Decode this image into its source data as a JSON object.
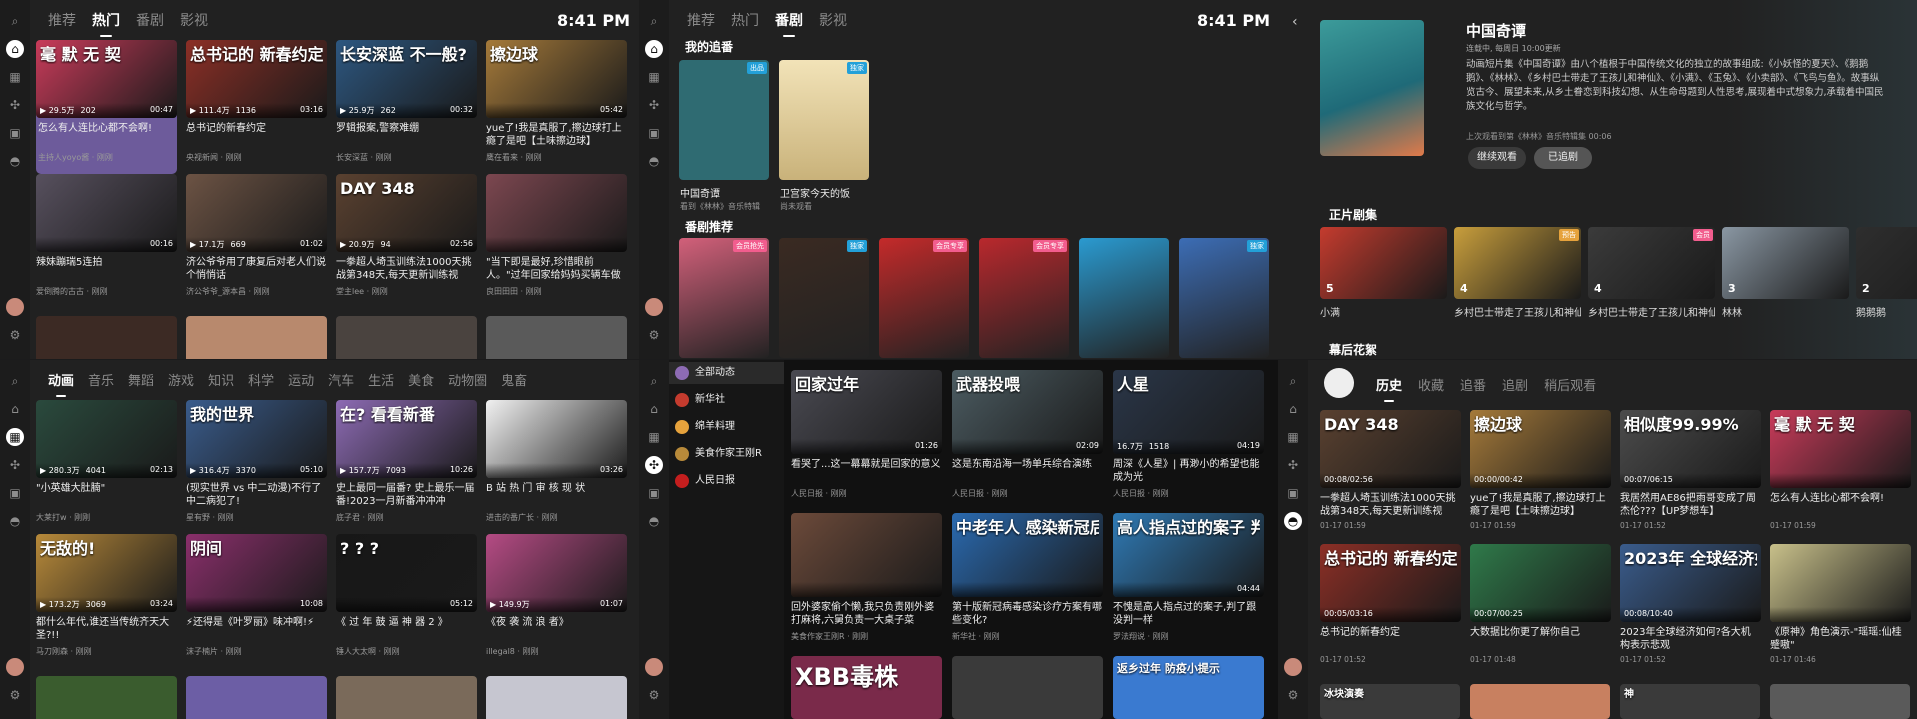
{
  "colors": {
    "bg": "#212121",
    "rail": "#1c1c1c",
    "accent": "#ffffff",
    "highlight": "#6d5b9b"
  },
  "p1": {
    "tabs": [
      "推荐",
      "热门",
      "番剧",
      "影视"
    ],
    "active_tab": 1,
    "time": "8:41 PM",
    "cards": [
      {
        "thumb_text": "毫 默 无 契",
        "title": "怎么有人连比心都不会啊!",
        "uploader": "主持人yoyo酱 · 刚刚",
        "views": "29.5万",
        "danmaku": "202",
        "duration": "00:47",
        "bg": "#c93b5a",
        "hl": true
      },
      {
        "thumb_text": "总书记的 新春约定",
        "title": "总书记的新春约定",
        "uploader": "央视新闻 · 刚刚",
        "views": "111.4万",
        "danmaku": "1136",
        "duration": "03:16",
        "bg": "#8c2f26"
      },
      {
        "thumb_text": "长安深蓝 不一般?",
        "title": "罗辑报案,警察难绷",
        "uploader": "长安深蓝 · 刚刚",
        "views": "25.9万",
        "danmaku": "262",
        "duration": "00:32",
        "bg": "#2d5780"
      },
      {
        "thumb_text": "擦边球",
        "title": "yue了!我是真服了,擦边球打上瘾了是吧【土味擦边球】",
        "uploader": "鹰在看来 · 刚刚",
        "views": "",
        "danmaku": "",
        "duration": "05:42",
        "bg": "#a57a3a"
      },
      {
        "thumb_text": "",
        "title": "辣妹蹦瑞5连拍",
        "uploader": "爱倒腾的古古 · 刚刚",
        "views": "",
        "danmaku": "",
        "duration": "00:16",
        "bg": "#57505e"
      },
      {
        "thumb_text": "",
        "title": "济公爷爷用了康复后对老人们说个悄悄话",
        "uploader": "济公爷爷_源本昌 · 刚刚",
        "views": "17.1万",
        "danmaku": "669",
        "duration": "01:02",
        "bg": "#6c5344"
      },
      {
        "thumb_text": "DAY 348",
        "title": "一拳超人埼玉训练法1000天挑战第348天,每天更新训练视",
        "uploader": "堂主lee · 刚刚",
        "views": "20.9万",
        "danmaku": "94",
        "duration": "02:56",
        "bg": "#5a4130"
      },
      {
        "thumb_text": "",
        "title": "\"当下即是最好,珍惜眼前人。\"过年回家给妈妈买辆车做",
        "uploader": "良田田田 · 刚刚",
        "views": "",
        "danmaku": "",
        "duration": "",
        "bg": "#7c4750"
      }
    ],
    "row3": [
      "#3c2a24",
      "#b8896d",
      "#4a433f",
      "#5a5a5a"
    ]
  },
  "p2": {
    "tabs": [
      "推荐",
      "热门",
      "番剧",
      "影视"
    ],
    "active_tab": 2,
    "time": "8:41 PM",
    "my_follow_label": "我的追番",
    "follows": [
      {
        "title": "中国奇谭",
        "sub": "看到《林林》音乐特辑",
        "badge": "出品",
        "bg": "#2f6b72"
      },
      {
        "title": "卫宫家今天的饭",
        "sub": "尚未观看",
        "badge": "独家",
        "bg": "#d9c59a"
      }
    ],
    "rec_label": "番剧推荐",
    "recs": [
      {
        "bg": "#d2607a",
        "badge": "会员抢先"
      },
      {
        "bg": "#3a2a22",
        "badge": "独家"
      },
      {
        "bg": "#c42a2a",
        "badge": "会员专享"
      },
      {
        "bg": "#b9282d",
        "badge": "会员专享"
      },
      {
        "bg": "#2a9ad0",
        "badge": ""
      },
      {
        "bg": "#3c6db5",
        "badge": "独家"
      }
    ]
  },
  "p3": {
    "title": "中国奇谭",
    "meta": "连载中, 每周日 10:00更新",
    "desc": "动画短片集《中国奇谭》由八个植根于中国传统文化的独立的故事组成:《小妖怪的夏天》、《鹅鹅鹅》、《林林》、《乡村巴士带走了王孩儿和神仙》、《小满》、《玉兔》、《小卖部》、《飞鸟与鱼》。故事纵览古今、展望未来,从乡土眷恋到科技幻想、从生命母题到人性思考,展现着中式想象力,承载着中国民族文化与哲学。",
    "last": "上次观看到第《林林》音乐特辑集 00:06",
    "btn_continue": "继续观看",
    "btn_followed": "已追剧",
    "episodes_label": "正片剧集",
    "episodes": [
      {
        "num": "5",
        "label": "小满",
        "bg": "#c43b2e"
      },
      {
        "num": "4",
        "label": "乡村巴士带走了王孩儿和神仙",
        "bg": "#c89e3c",
        "badge": "预告"
      },
      {
        "num": "4",
        "label": "乡村巴士带走了王孩儿和神仙",
        "bg": "#3b3b3b",
        "badge": "会员"
      },
      {
        "num": "3",
        "label": "林林",
        "bg": "#8a97a3"
      },
      {
        "num": "2",
        "label": "鹅鹅鹅",
        "bg": "#2e2e2e"
      }
    ],
    "extras_label": "幕后花絮"
  },
  "p4": {
    "tabs": [
      "动画",
      "音乐",
      "舞蹈",
      "游戏",
      "知识",
      "科学",
      "运动",
      "汽车",
      "生活",
      "美食",
      "动物圈",
      "鬼畜"
    ],
    "active_tab": 0,
    "cards": [
      {
        "thumb_text": "",
        "title": "\"小英雄大肚腩\"",
        "uploader": "大莱打w · 刚刚",
        "views": "280.3万",
        "danmaku": "4041",
        "duration": "02:13",
        "bg": "#2a4a3d"
      },
      {
        "thumb_text": "我的世界",
        "title": "(现实世界 vs 中二动漫)不行了中二病犯了!",
        "uploader": "星有野 · 刚刚",
        "views": "316.4万",
        "danmaku": "3370",
        "duration": "05:10",
        "bg": "#3a5c8c"
      },
      {
        "thumb_text": "在? 看看新番",
        "title": "史上最同一届番? 史上最乐一届番!2023一月新番冲冲冲",
        "uploader": "底子君 · 刚刚",
        "views": "157.7万",
        "danmaku": "7093",
        "duration": "10:26",
        "bg": "#8d6bb4"
      },
      {
        "thumb_text": "",
        "title": "B 站 热 门 审 核 现 状",
        "uploader": "进击的番广长 · 刚刚",
        "views": "",
        "danmaku": "",
        "duration": "03:26",
        "bg": "#f1f1f1"
      },
      {
        "thumb_text": "无敌的!",
        "title": "都什么年代,谁还当传统齐天大圣?!!",
        "uploader": "马刀刚森 · 刚刚",
        "views": "173.2万",
        "danmaku": "3069",
        "duration": "03:24",
        "bg": "#b88a3a"
      },
      {
        "thumb_text": "阴间",
        "title": "⚡还得是《叶罗丽》味冲啊!⚡",
        "uploader": "沫子楠片 · 刚刚",
        "views": "",
        "danmaku": "",
        "duration": "10:08",
        "bg": "#8a2f6b"
      },
      {
        "thumb_text": "? ? ?",
        "title": "《 过 年 鼓 逼 神 器 2 》",
        "uploader": "锤人大太啊 · 刚刚",
        "views": "",
        "danmaku": "",
        "duration": "05:12",
        "bg": "#171717"
      },
      {
        "thumb_text": "",
        "title": "《夜 袭 流 浪 者》",
        "uploader": "illegal8 · 刚刚",
        "views": "149.9万",
        "danmaku": "",
        "duration": "01:07",
        "bg": "#b54b84"
      }
    ],
    "row3": [
      "#3a5c2e",
      "#6c5ea5",
      "#7a6a5a",
      "#c6c6d0"
    ]
  },
  "p5": {
    "side": [
      {
        "label": "全部动态",
        "color": "#8d6bb4"
      },
      {
        "label": "新华社",
        "color": "#c43b2e"
      },
      {
        "label": "绵羊料理",
        "color": "#e6a23c"
      },
      {
        "label": "美食作家王刚R",
        "color": "#b88a3a"
      },
      {
        "label": "人民日报",
        "color": "#c41e1e"
      }
    ],
    "active": 0,
    "cards": [
      {
        "thumb_text": "回家过年",
        "title": "看哭了...这一幕幕就是回家的意义",
        "uploader": "人民日报 · 刚刚",
        "views": "",
        "danmaku": "",
        "duration": "01:26",
        "bg": "#4a4a52"
      },
      {
        "thumb_text": "武器投喂",
        "title": "这是东南沿海一场单兵综合演练",
        "uploader": "人民日报 · 刚刚",
        "views": "",
        "danmaku": "",
        "duration": "02:09",
        "bg": "#4c5c62"
      },
      {
        "thumb_text": "人星",
        "title": "周深《人星》| 再渺小的希望也能成为光",
        "uploader": "人民日报 · 刚刚",
        "views": "16.7万",
        "danmaku": "1518",
        "duration": "04:19",
        "bg": "#2a3648"
      },
      {
        "thumb_text": "",
        "title": "回外婆家偷个懒,我只负责刚外婆打麻将,六舅负责一大桌子菜",
        "uploader": "美食作家王刚R · 刚刚",
        "views": "",
        "danmaku": "",
        "duration": "",
        "bg": "#6c4a3a"
      },
      {
        "thumb_text": "中老年人 感染新冠后",
        "title": "第十版新冠病毒感染诊疗方案有哪些变化?",
        "uploader": "新华社 · 刚刚",
        "views": "",
        "danmaku": "",
        "duration": "",
        "bg": "#2a6ab0"
      },
      {
        "thumb_text": "高人指点过的案子 判了跟没判一样",
        "title": "不愧是高人指点过的案子,判了跟没判一样",
        "uploader": "罗法翔说 · 刚刚",
        "views": "",
        "danmaku": "",
        "duration": "04:44",
        "bg": "#2f7ab5"
      }
    ],
    "row3": [
      {
        "text": "XBB毒株",
        "bg": "#7a2a4a"
      },
      {
        "text": "",
        "bg": "#3a3a3a"
      },
      {
        "text": "返乡过年 防疫小提示",
        "bg": "#3a7ad0"
      }
    ]
  },
  "p6": {
    "tabs": [
      "历史",
      "收藏",
      "追番",
      "追剧",
      "稍后观看"
    ],
    "active_tab": 0,
    "cards": [
      {
        "thumb_text": "DAY 348",
        "title": "一拳超人埼玉训练法1000天挑战第348天,每天更新训练视",
        "date": "01-17 01:59",
        "progress": "00:08/02:56",
        "bg": "#5a4130"
      },
      {
        "thumb_text": "擦边球",
        "title": "yue了!我是真服了,擦边球打上瘾了是吧【土味擦边球】",
        "date": "01-17 01:59",
        "progress": "00:00/00:42",
        "bg": "#a57a3a"
      },
      {
        "thumb_text": "相似度99.99%",
        "title": "我居然用AE86把雨哥变成了周杰伦???【UP梦想车】",
        "date": "01-17 01:52",
        "progress": "00:07/06:15",
        "bg": "#4c4c4c"
      },
      {
        "thumb_text": "毫 默 无 契",
        "title": "怎么有人连比心都不会啊!",
        "date": "01-17 01:59",
        "progress": "",
        "bg": "#c93b5a"
      },
      {
        "thumb_text": "总书记的 新春约定",
        "title": "总书记的新春约定",
        "date": "01-17 01:52",
        "progress": "00:05/03:16",
        "bg": "#8c2f26"
      },
      {
        "thumb_text": "",
        "title": "大数据比你更了解你自己",
        "date": "01-17 01:48",
        "progress": "00:07/00:25",
        "bg": "#2f7a4a"
      },
      {
        "thumb_text": "2023年 全球经济如何?",
        "title": "2023年全球经济如何?各大机构表示悲观",
        "date": "01-17 01:52",
        "progress": "00:08/10:40",
        "bg": "#3a5c8c"
      },
      {
        "thumb_text": "",
        "title": "《原神》角色演示-\"瑶瑶:仙桂蹙嗷\"",
        "date": "01-17 01:46",
        "progress": "",
        "bg": "#c8c08a"
      }
    ],
    "row3": [
      {
        "text": "冰块演奏",
        "bg": "#3a3a3a"
      },
      {
        "text": "",
        "bg": "#c88060"
      },
      {
        "text": "神",
        "bg": "#3a3a3a"
      },
      {
        "text": "",
        "bg": "#5a5a5a"
      }
    ]
  }
}
